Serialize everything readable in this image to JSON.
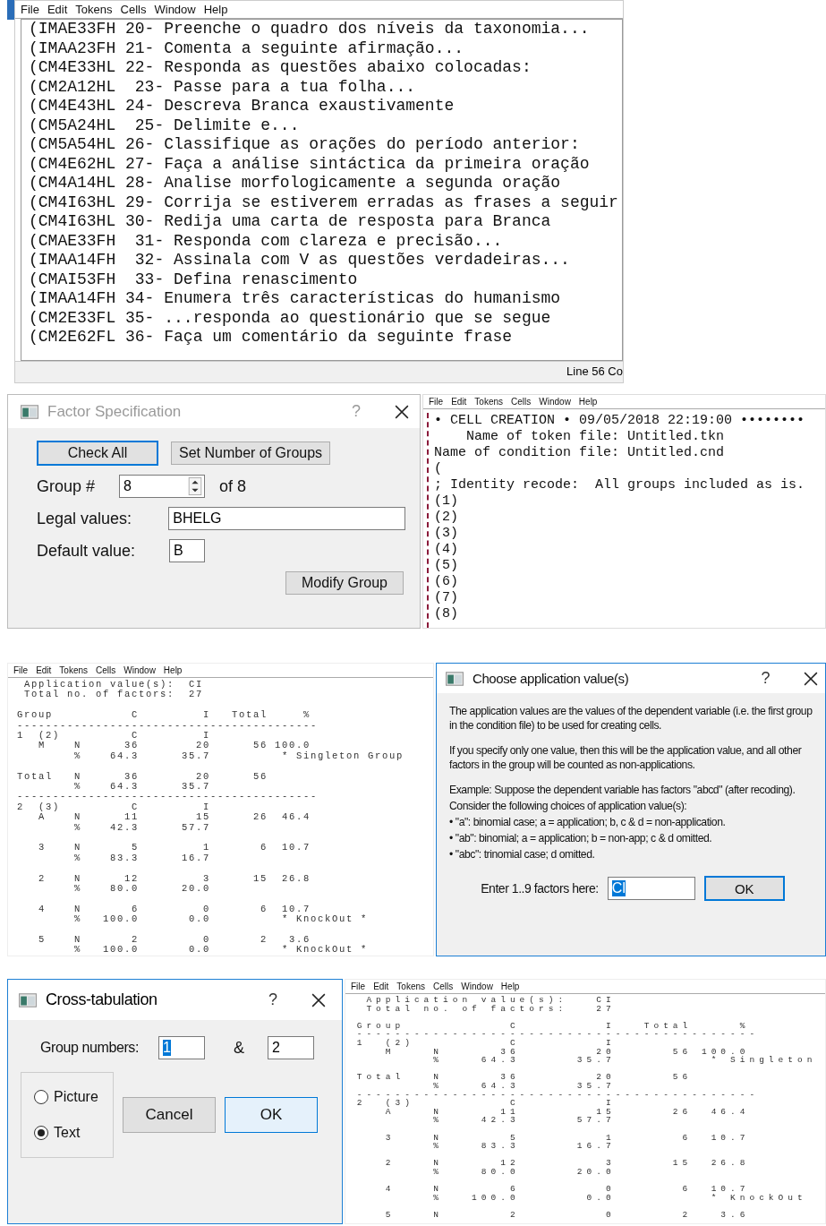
{
  "token_window": {
    "menu": [
      "File",
      "Edit",
      "Tokens",
      "Cells",
      "Window",
      "Help"
    ],
    "lines": [
      "(IMAE33FH 20- Preenche o quadro dos níveis da taxonomia...",
      "(IMAA23FH 21- Comenta a seguinte afirmação...",
      "(CM4E33HL 22- Responda as questões abaixo colocadas:",
      "(CM2A12HL  23- Passe para a tua folha...",
      "(CM4E43HL 24- Descreva Branca exaustivamente",
      "(CM5A24HL  25- Delimite e...",
      "(CM5A54HL 26- Classifique as orações do período anterior:",
      "(CM4E62HL 27- Faça a análise sintáctica da primeira oração",
      "(CM4A14HL 28- Analise morfologicamente a segunda oração",
      "(CM4I63HL 29- Corrija se estiverem erradas as frases a seguir",
      "(CM4I63HL 30- Redija uma carta de resposta para Branca",
      "(CMAE33FH  31- Responda com clareza e precisão...",
      "(IMAA14FH  32- Assinala com V as questões verdadeiras...",
      "(CMAI53FH  33- Defina renascimento",
      "(IMAA14FH 34- Enumera três características do humanismo",
      "(CM2E33FL 35- ...responda ao questionário que se segue",
      "(CM2E62FL 36- Faça um comentário da seguinte frase"
    ],
    "status_bar": "Line 56 Co"
  },
  "factor_dialog": {
    "title": "Factor Specification",
    "help": "?",
    "top_buttons": [
      {
        "label": "Check All",
        "default": true
      },
      {
        "label": "Set Number of Groups",
        "default": false
      }
    ],
    "group_label": "Group #",
    "group_value": "8",
    "group_of": "of 8",
    "legal_label": "Legal values:",
    "legal_value": "BHELG",
    "default_label": "Default value:",
    "default_value": "B",
    "modify_button": {
      "label": "Modify Group",
      "default": false
    }
  },
  "cell_window": {
    "menu": [
      "File",
      "Edit",
      "Tokens",
      "Cells",
      "Window",
      "Help"
    ],
    "lines": [
      "• CELL CREATION • 09/05/2018 22:19:00 ••••••••",
      "    Name of token file: Untitled.tkn",
      "Name of condition file: Untitled.cnd",
      "(",
      "; Identity recode:  All groups included as is.",
      "(1)",
      "(2)",
      "(3)",
      "(4)",
      "(5)",
      "(6)",
      "(7)",
      "(8)"
    ]
  },
  "results_window": {
    "menu": [
      "File",
      "Edit",
      "Tokens",
      "Cells",
      "Window",
      "Help"
    ],
    "blocks": [
      [
        "  Application value(s):  CI",
        "  Total no. of factors:  27"
      ],
      [
        " Group           C         I   Total     %",
        " ------------------------------------------",
        " 1  (2)          C         I",
        "    M    N      36        20      56 100.0",
        "         %    64.3      35.7          * Singleton Group"
      ],
      [
        " Total   N      36        20      56",
        "         %    64.3      35.7",
        " ------------------------------------------",
        " 2  (3)          C         I",
        "    A    N      11        15      26  46.4",
        "         %    42.3      57.7"
      ],
      [
        "    3    N       5         1       6  10.7",
        "         %    83.3      16.7"
      ],
      [
        "    2    N      12         3      15  26.8",
        "         %    80.0      20.0"
      ],
      [
        "    4    N       6         0       6  10.7",
        "         %   100.0       0.0          * KnockOut *"
      ],
      [
        "    5    N       2         0       2   3.6",
        "         %   100.0       0.0          * KnockOut *"
      ]
    ]
  },
  "application_dialog": {
    "title": "Choose application value(s)",
    "help": "?",
    "paragraphs": [
      [
        "The application values are the values of the dependent variable (i.e. the first group in the condition file) to be used for creating cells."
      ],
      [
        "If you specify only one value, then this will be the application value, and all other factors in the group will be counted as non-applications."
      ],
      [
        "Example: Suppose the dependent variable has factors \"abcd\" (after recoding).",
        "Consider the following choices of application value(s):",
        "• \"a\": binomial case; a = application; b, c & d = non-application.",
        "• \"ab\": binomial; a = application; b = non-app; c & d omitted.",
        "• \"abc\": trinomial case; d omitted."
      ]
    ],
    "field_label": "Enter 1..9 factors here:",
    "field_value": "CI",
    "field_text_selected": true,
    "ok_button": {
      "label": "OK",
      "default": true
    }
  },
  "crosstab_dialog": {
    "title": "Cross-tabulation",
    "help": "?",
    "group_label": "Group numbers:",
    "group_1": "1",
    "group_1_text_selected": true,
    "joiner": "&",
    "group_2": "2",
    "options": [
      {
        "label": "Picture",
        "selected": false
      },
      {
        "label": "Text",
        "selected": true
      }
    ],
    "buttons": [
      {
        "label": "Cancel",
        "default": false
      },
      {
        "label": "OK",
        "default": true
      }
    ]
  },
  "crosstab_window": {
    "menu": [
      "File",
      "Edit",
      "Tokens",
      "Cells",
      "Window",
      "Help"
    ],
    "blocks": [
      [
        "  Application value(s):   CI",
        "  Total no. of factors:   27"
      ],
      [
        " Group           C         I   Total     %",
        " ------------------------------------------",
        " 1  (2)          C         I",
        "    M    N      36        20      56 100.0",
        "         %    64.3      35.7          * Singleton"
      ],
      [
        " Total   N      36        20      56",
        "         %    64.3      35.7",
        " ------------------------------------------",
        " 2  (3)          C         I",
        "    A    N      11        15      26  46.4",
        "         %    42.3      57.7"
      ],
      [
        "    3    N       5         1       6  10.7",
        "         %    83.3      16.7"
      ],
      [
        "    2    N      12         3      15  26.8",
        "         %    80.0      20.0"
      ],
      [
        "    4    N       6         0       6  10.7",
        "         %   100.0       0.0          * KnockOut"
      ],
      [
        "    5    N       2         0       2   3.6"
      ]
    ]
  }
}
